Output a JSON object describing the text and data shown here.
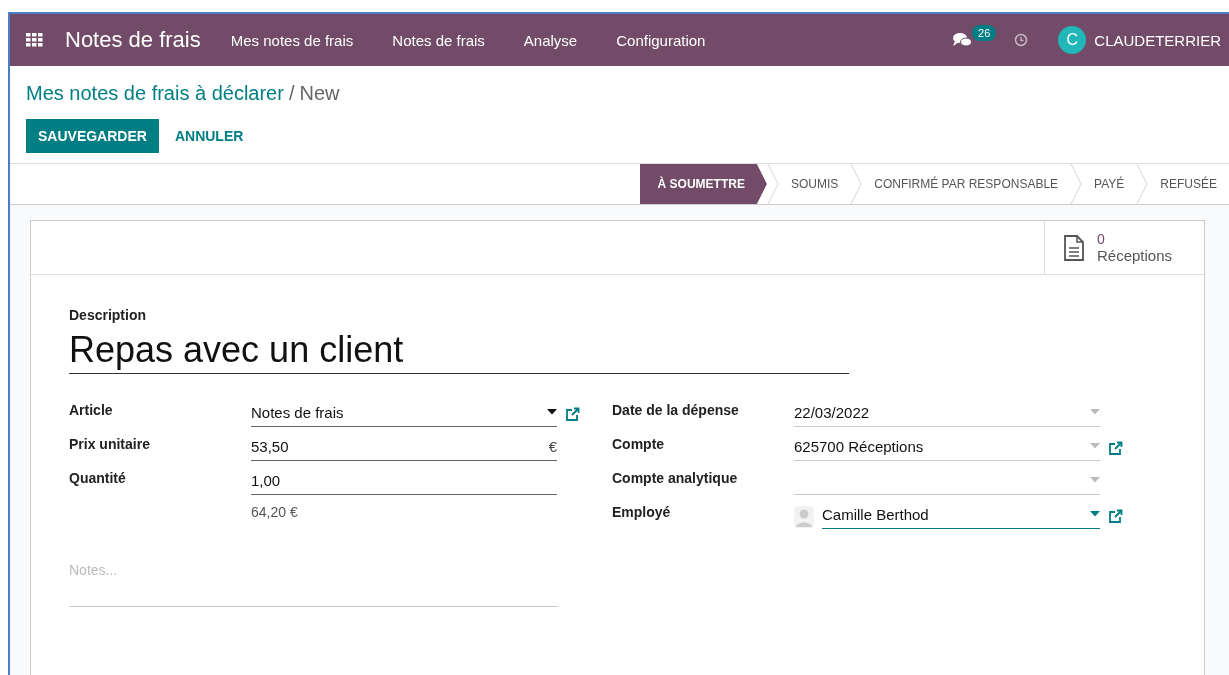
{
  "navbar": {
    "app_title": "Notes de frais",
    "menu": [
      {
        "label": "Mes notes de frais"
      },
      {
        "label": "Notes de frais"
      },
      {
        "label": "Analyse"
      },
      {
        "label": "Configuration"
      }
    ],
    "messages_count": "26",
    "user": {
      "initial": "C",
      "name": "CLAUDETERRIER"
    }
  },
  "breadcrumb": {
    "parent": "Mes notes de frais à déclarer",
    "separator": "/",
    "current": "New"
  },
  "buttons": [
    {
      "label": "SAUVEGARDER",
      "kind": "primary"
    },
    {
      "label": "ANNULER",
      "kind": "secondary"
    }
  ],
  "statusbar": [
    {
      "label": "À SOUMETTRE",
      "selected": true
    },
    {
      "label": "SOUMIS",
      "selected": false
    },
    {
      "label": "CONFIRMÉ PAR RESPONSABLE",
      "selected": false
    },
    {
      "label": "PAYÉ",
      "selected": false
    },
    {
      "label": "REFUSÉE",
      "selected": false
    }
  ],
  "smart_button": {
    "count": "0",
    "label": "Réceptions"
  },
  "form": {
    "description_label": "Description",
    "description": "Repas avec un client",
    "left_fields": [
      {
        "label": "Article",
        "value": "Notes de frais",
        "kind": "select",
        "required": true,
        "link": true,
        "focused": false
      },
      {
        "label": "Prix unitaire",
        "value": "53,50",
        "kind": "input",
        "suffix": "€",
        "required": true,
        "focused": false
      },
      {
        "label": "Quantité",
        "value": "1,00",
        "kind": "input",
        "required": true,
        "focused": false
      },
      {
        "value": "64,20 €",
        "kind": "readonly"
      }
    ],
    "right_fields": [
      {
        "label": "Date de la dépense",
        "value": "22/03/2022",
        "kind": "select",
        "required": false,
        "link": false,
        "focused": false
      },
      {
        "label": "Compte",
        "value": "625700 Réceptions",
        "kind": "select",
        "required": false,
        "link": true,
        "focused": false
      },
      {
        "label": "Compte analytique",
        "kind": "select",
        "required": false,
        "link": false,
        "focused": false
      },
      {
        "label": "Employé",
        "value": "Camille Berthod",
        "kind": "select",
        "required": false,
        "link": true,
        "focused": true,
        "avatar": true
      }
    ],
    "notes_placeholder": "Notes..."
  }
}
